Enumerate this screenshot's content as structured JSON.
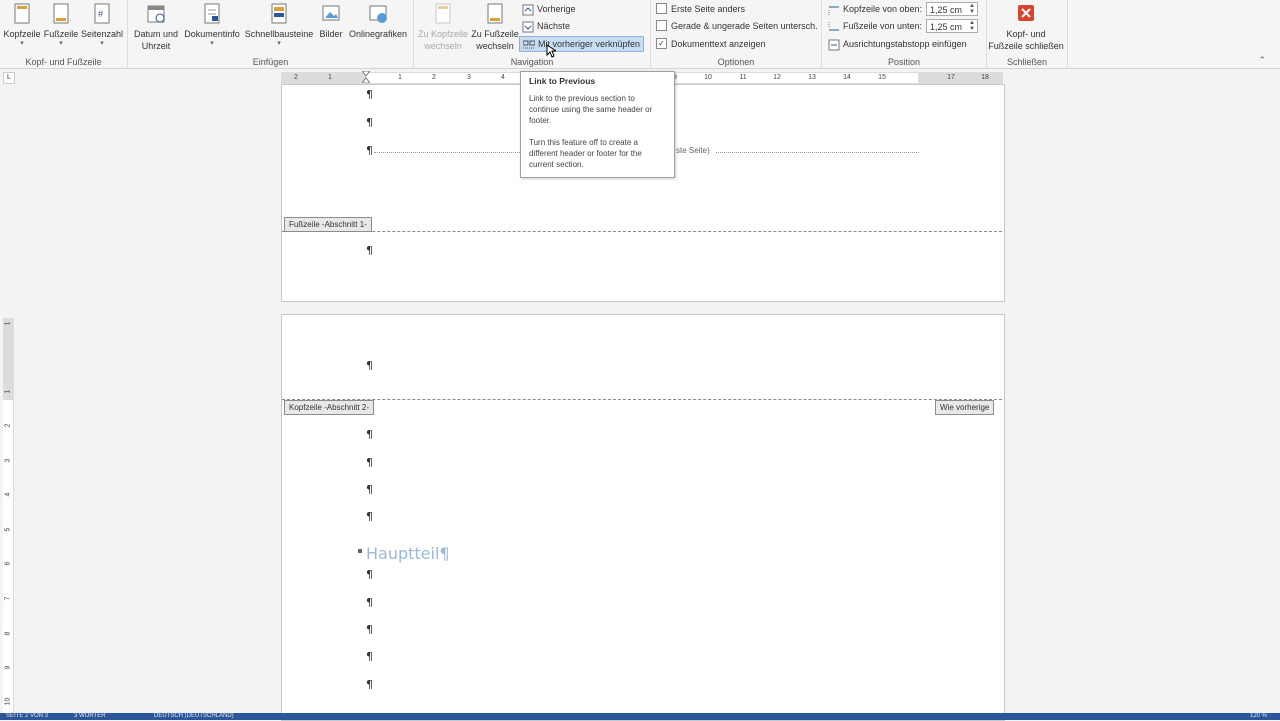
{
  "ribbon": {
    "groups": {
      "kopf_fusszeile": {
        "label": "Kopf- und Fußzeile",
        "buttons": [
          {
            "label": "Kopfzeile"
          },
          {
            "label": "Fußzeile"
          },
          {
            "label": "Seitenzahl"
          }
        ]
      },
      "einfuegen": {
        "label": "Einfügen",
        "buttons": [
          {
            "label1": "Datum und",
            "label2": "Uhrzeit"
          },
          {
            "label": "Dokumentinfo"
          },
          {
            "label": "Schnellbausteine"
          },
          {
            "label": "Bilder"
          },
          {
            "label": "Onlinegrafiken"
          }
        ]
      },
      "navigation": {
        "label": "Navigation",
        "zu_kopfzeile": {
          "label1": "Zu Kopfzeile",
          "label2": "wechseln"
        },
        "zu_fusszeile": {
          "label1": "Zu Fußzeile",
          "label2": "wechseln"
        },
        "vorherige": "Vorherige",
        "naechste": "Nächste",
        "verknuepfen": "Mit vorheriger verknüpfen"
      },
      "optionen": {
        "label": "Optionen",
        "checks": [
          {
            "label": "Erste Seite anders",
            "checked": false
          },
          {
            "label": "Gerade & ungerade Seiten untersch.",
            "checked": false
          },
          {
            "label": "Dokumenttext anzeigen",
            "checked": true
          }
        ]
      },
      "position": {
        "label": "Position",
        "kopf_label": "Kopfzeile von oben:",
        "kopf_value": "1,25  cm",
        "fuss_label": "Fußzeile von unten:",
        "fuss_value": "1,25  cm",
        "tab_label": "Ausrichtungstabstopp einfügen"
      },
      "schliessen": {
        "label": "Schließen",
        "btn_label1": "Kopf- und",
        "btn_label2": "Fußzeile schließen"
      }
    },
    "ruler_tab_symbol": "L"
  },
  "ruler": {
    "h_numbers": [
      "2",
      "1",
      "1",
      "2",
      "3",
      "4",
      "9",
      "10",
      "11",
      "12",
      "13",
      "14",
      "15",
      "17",
      "18"
    ],
    "v_numbers": [
      "1",
      "1",
      "2",
      "3",
      "4",
      "5",
      "6",
      "7",
      "8",
      "9",
      "10"
    ]
  },
  "tooltip": {
    "title": "Link to Previous",
    "text1": "Link to the previous section to continue using the same header or footer.",
    "text2": "Turn this feature off to create a different header or footer for the current section."
  },
  "document": {
    "pilcrow": "¶",
    "section_break_text": "ste Seite)",
    "footer_tag": "Fußzeile -Abschnitt 1-",
    "header_tag": "Kopfzeile -Abschnitt 2-",
    "same_as_previous": "Wie vorherige",
    "heading": "Hauptteil",
    "heading_mark": "¶"
  },
  "colors": {
    "accent": "#2b579a",
    "heading": "#9cb8d8",
    "close_red": "#d9432f"
  },
  "statusbar": {
    "page": "SEITE 2 VON 3",
    "words": "3 WÖRTER",
    "language": "DEUTSCH (DEUTSCHLAND)",
    "zoom": "120 %"
  }
}
